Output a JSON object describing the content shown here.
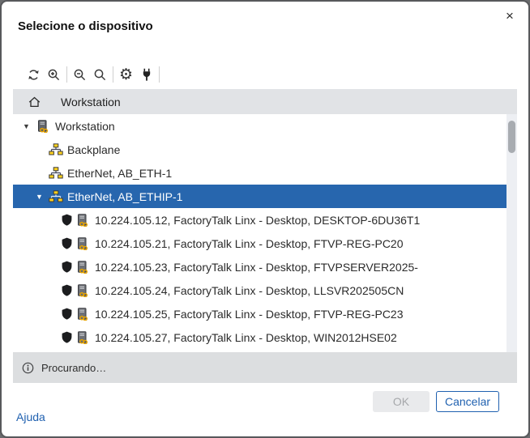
{
  "dialog": {
    "title": "Selecione o dispositivo"
  },
  "icons": {
    "close": "×",
    "expand_arrow": "▼",
    "settings_gear": "⚙"
  },
  "toolbar": {
    "groups": [
      [
        "refresh",
        "zoom-in"
      ],
      [
        "zoom-out",
        "search"
      ],
      [
        "settings",
        "plug"
      ]
    ]
  },
  "breadcrumb": {
    "home_icon": "home-icon",
    "label": "Workstation"
  },
  "tree": {
    "items": [
      {
        "label": "Workstation",
        "level": 0,
        "expanded": true,
        "icon": "workstation"
      },
      {
        "label": "Backplane",
        "level": 1,
        "icon": "network"
      },
      {
        "label": "EtherNet, AB_ETH-1",
        "level": 1,
        "icon": "network"
      },
      {
        "label": "EtherNet, AB_ETHIP-1",
        "level": 1,
        "expanded": true,
        "selected": true,
        "icon": "network"
      },
      {
        "label": "10.224.105.12, FactoryTalk Linx - Desktop, DESKTOP-6DU36T1",
        "level": 2,
        "icon": "device",
        "shield": true
      },
      {
        "label": "10.224.105.21, FactoryTalk Linx - Desktop, FTVP-REG-PC20",
        "level": 2,
        "icon": "device",
        "shield": true
      },
      {
        "label": "10.224.105.23, FactoryTalk Linx - Desktop, FTVPSERVER2025-",
        "level": 2,
        "icon": "device",
        "shield": true
      },
      {
        "label": "10.224.105.24, FactoryTalk Linx - Desktop, LLSVR202505CN",
        "level": 2,
        "icon": "device",
        "shield": true
      },
      {
        "label": "10.224.105.25, FactoryTalk Linx - Desktop, FTVP-REG-PC23",
        "level": 2,
        "icon": "device",
        "shield": true
      },
      {
        "label": "10.224.105.27, FactoryTalk Linx - Desktop, WIN2012HSE02",
        "level": 2,
        "icon": "device",
        "shield": true
      },
      {
        "label": "",
        "level": 2,
        "icon": "device",
        "shield": true,
        "partial": true
      }
    ]
  },
  "status": {
    "text": "Procurando…"
  },
  "footer": {
    "ok_label": "OK",
    "ok_enabled": false,
    "cancel_label": "Cancelar",
    "help_label": "Ajuda"
  },
  "colors": {
    "selected_row": "#2766ae",
    "link": "#2061b0",
    "toolbar_icon": "#3a3a3a",
    "breadcrumb_bg": "#e1e3e6",
    "status_bg": "#dcdee0"
  }
}
